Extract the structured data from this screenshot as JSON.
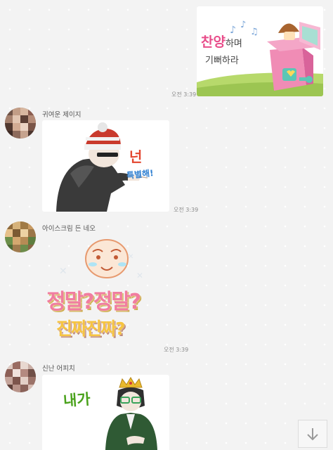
{
  "colors": {
    "background": "#f3f3f3",
    "sticker_bg": "#ffffff",
    "sender_name": "#555555",
    "timestamp": "#8c8c8c"
  },
  "messages": [
    {
      "direction": "outgoing",
      "sticker": {
        "text_line1": "찬양",
        "text_line1_suffix": "하며",
        "text_line2": "기뻐하라",
        "icon": "music-box-sticker"
      },
      "time": "오전 3:39"
    },
    {
      "direction": "incoming",
      "sender": "귀여운 제이지",
      "sticker": {
        "text_line1": "넌",
        "text_line2": "특별해!",
        "icon": "pointing-man-sticker"
      },
      "time": "오전 3:39"
    },
    {
      "direction": "incoming",
      "sender": "아이스크림 든 네오",
      "sticker": {
        "text_line1": "정말?정말?",
        "text_line2": "진짜진짜?",
        "icon": "surprised-face-sticker"
      },
      "time": "오전 3:39"
    },
    {
      "direction": "incoming",
      "sender": "신난 어피치",
      "sticker": {
        "text_line1": "내가",
        "icon": "crowned-man-sticker"
      }
    }
  ],
  "scroll_button": {
    "icon": "arrow-down-icon"
  }
}
